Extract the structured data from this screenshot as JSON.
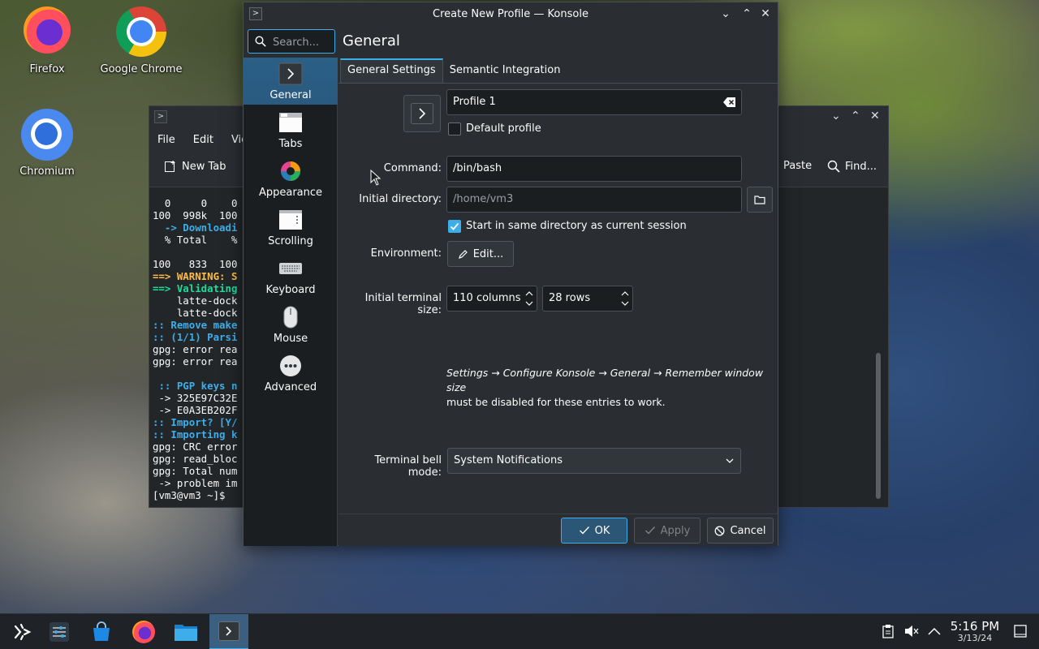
{
  "desktop": {
    "icons": [
      {
        "label": "Firefox"
      },
      {
        "label": "Google Chrome"
      },
      {
        "label": "Chromium"
      }
    ]
  },
  "background_window": {
    "menu": [
      "File",
      "Edit",
      "Vie"
    ],
    "toolbar": {
      "new_tab": "New Tab",
      "paste": "Paste",
      "find": "Find..."
    },
    "terminal_lines": [
      "  0     0    0",
      "100  998k  100",
      "  -> Downloadi",
      "  % Total    %",
      "",
      "100   833  100",
      "==> WARNING: S",
      "==> Validating",
      "    latte-dock",
      "    latte-dock",
      ":: Remove make",
      ":: (1/1) Parsi",
      "gpg: error rea",
      "gpg: error rea",
      "",
      " :: PGP keys n",
      " -> 325E97C32E",
      " -> E0A3EB202F",
      ":: Import? [Y/",
      ":: Importing k",
      "gpg: CRC error",
      "gpg: read_bloc",
      "gpg: Total num",
      " -> problem im",
      "[vm3@vm3 ~]$ "
    ]
  },
  "dialog": {
    "title": "Create New Profile — Konsole",
    "search_placeholder": "Search...",
    "page_heading": "General",
    "sidebar": [
      {
        "label": "General",
        "icon": "terminal-icon"
      },
      {
        "label": "Tabs",
        "icon": "tabs-icon"
      },
      {
        "label": "Appearance",
        "icon": "color-wheel-icon"
      },
      {
        "label": "Scrolling",
        "icon": "scrolling-icon"
      },
      {
        "label": "Keyboard",
        "icon": "keyboard-icon"
      },
      {
        "label": "Mouse",
        "icon": "mouse-icon"
      },
      {
        "label": "Advanced",
        "icon": "more-icon"
      }
    ],
    "tabs": [
      "General Settings",
      "Semantic Integration"
    ],
    "profile_name": "Profile 1",
    "default_profile_label": "Default profile",
    "command_label": "Command:",
    "command_value": "/bin/bash",
    "initial_dir_label": "Initial directory:",
    "initial_dir_placeholder": "/home/vm3",
    "same_dir_label": "Start in same directory as current session",
    "environment_label": "Environment:",
    "edit_label": "Edit...",
    "terminal_size_label": "Initial terminal size:",
    "columns_value": "110 columns",
    "rows_value": "28 rows",
    "note_line1": "Settings → Configure Konsole → General → Remember window size",
    "note_line2": "must be disabled for these entries to work.",
    "bell_label": "Terminal bell mode:",
    "bell_value": "System Notifications",
    "buttons": {
      "ok": "OK",
      "apply": "Apply",
      "cancel": "Cancel"
    }
  },
  "taskbar": {
    "time": "5:16 PM",
    "date": "3/13/24"
  },
  "colors": {
    "accent": "#3daee9",
    "window_bg": "#2a2e32",
    "field_bg": "#1b1e20"
  }
}
